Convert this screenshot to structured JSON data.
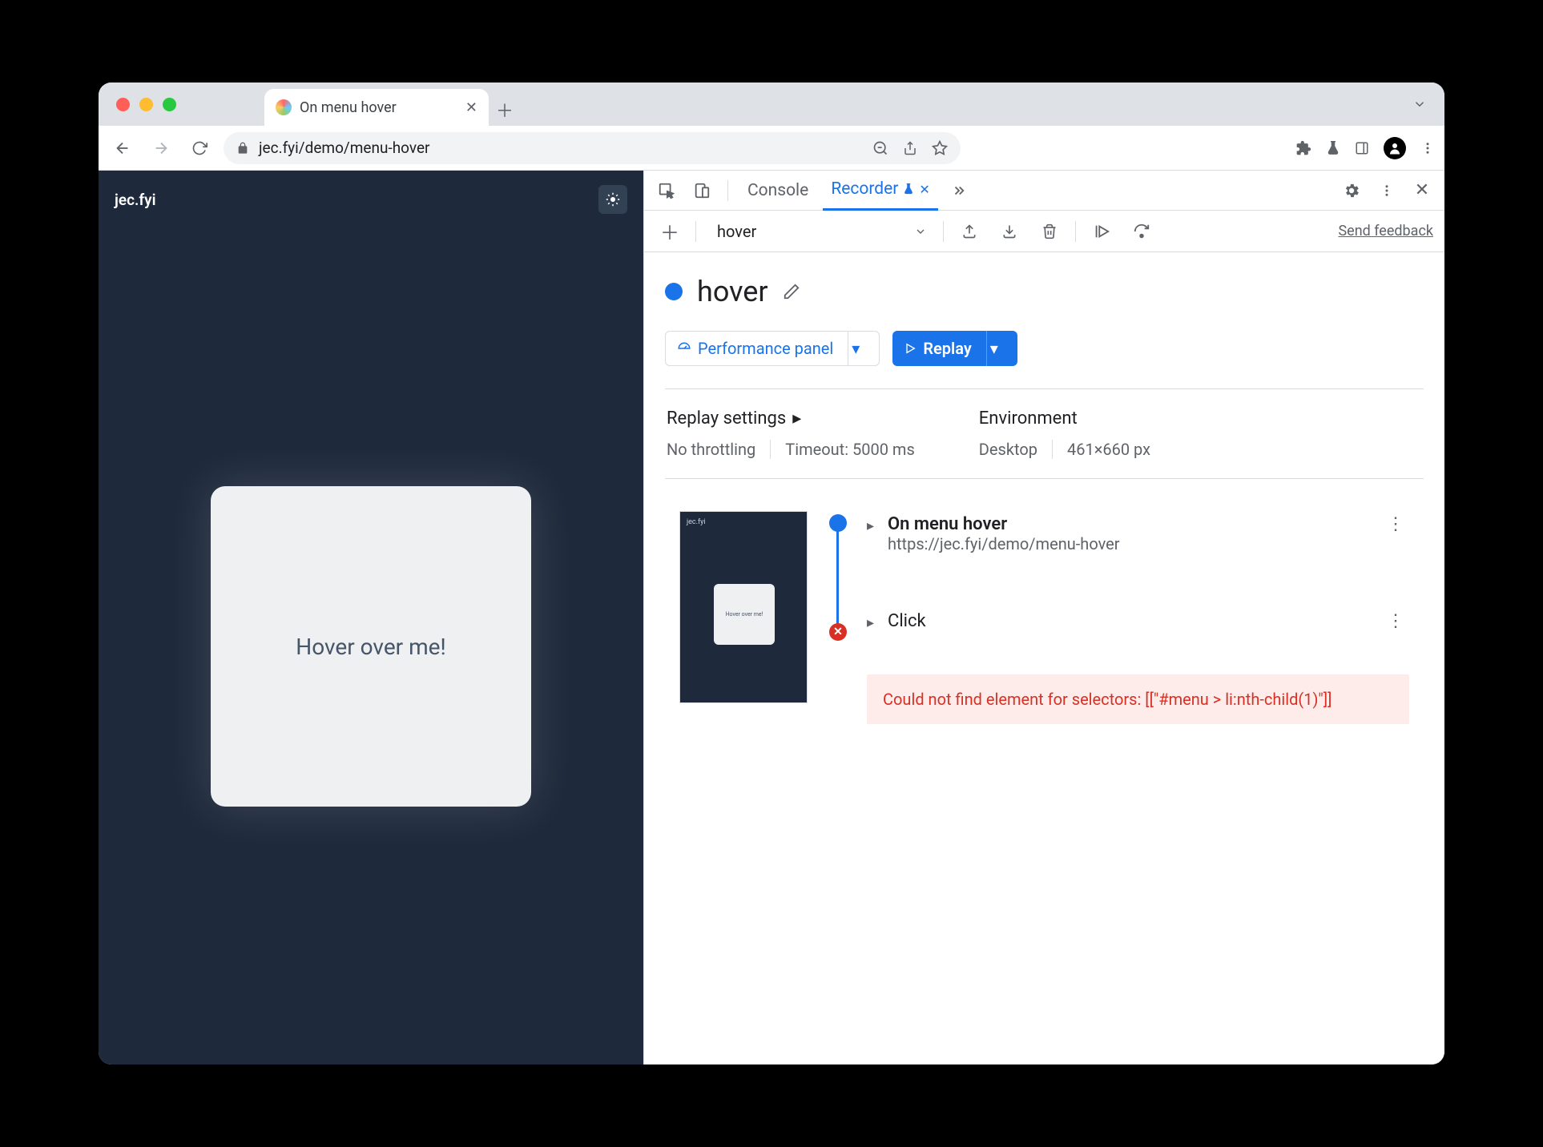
{
  "browser": {
    "tab_title": "On menu hover",
    "url": "jec.fyi/demo/menu-hover"
  },
  "page": {
    "site_title": "jec.fyi",
    "hover_text": "Hover over me!",
    "thumb_hover_text": "Hover over me!"
  },
  "devtools": {
    "tabs": {
      "console": "Console",
      "recorder": "Recorder"
    },
    "recorder": {
      "new_label": "New recording",
      "recording_select": "hover",
      "feedback": "Send feedback",
      "title": "hover",
      "perf_panel_btn": "Performance panel",
      "replay_btn": "Replay",
      "settings": {
        "replay_h": "Replay settings",
        "throttle": "No throttling",
        "timeout": "Timeout: 5000 ms",
        "env_h": "Environment",
        "env_device": "Desktop",
        "env_size": "461×660 px"
      },
      "steps": {
        "nav_title": "On menu hover",
        "nav_url": "https://jec.fyi/demo/menu-hover",
        "click_title": "Click",
        "error": "Could not find element for selectors: [[\"#menu > li:nth-child(1)\"]]"
      }
    }
  }
}
